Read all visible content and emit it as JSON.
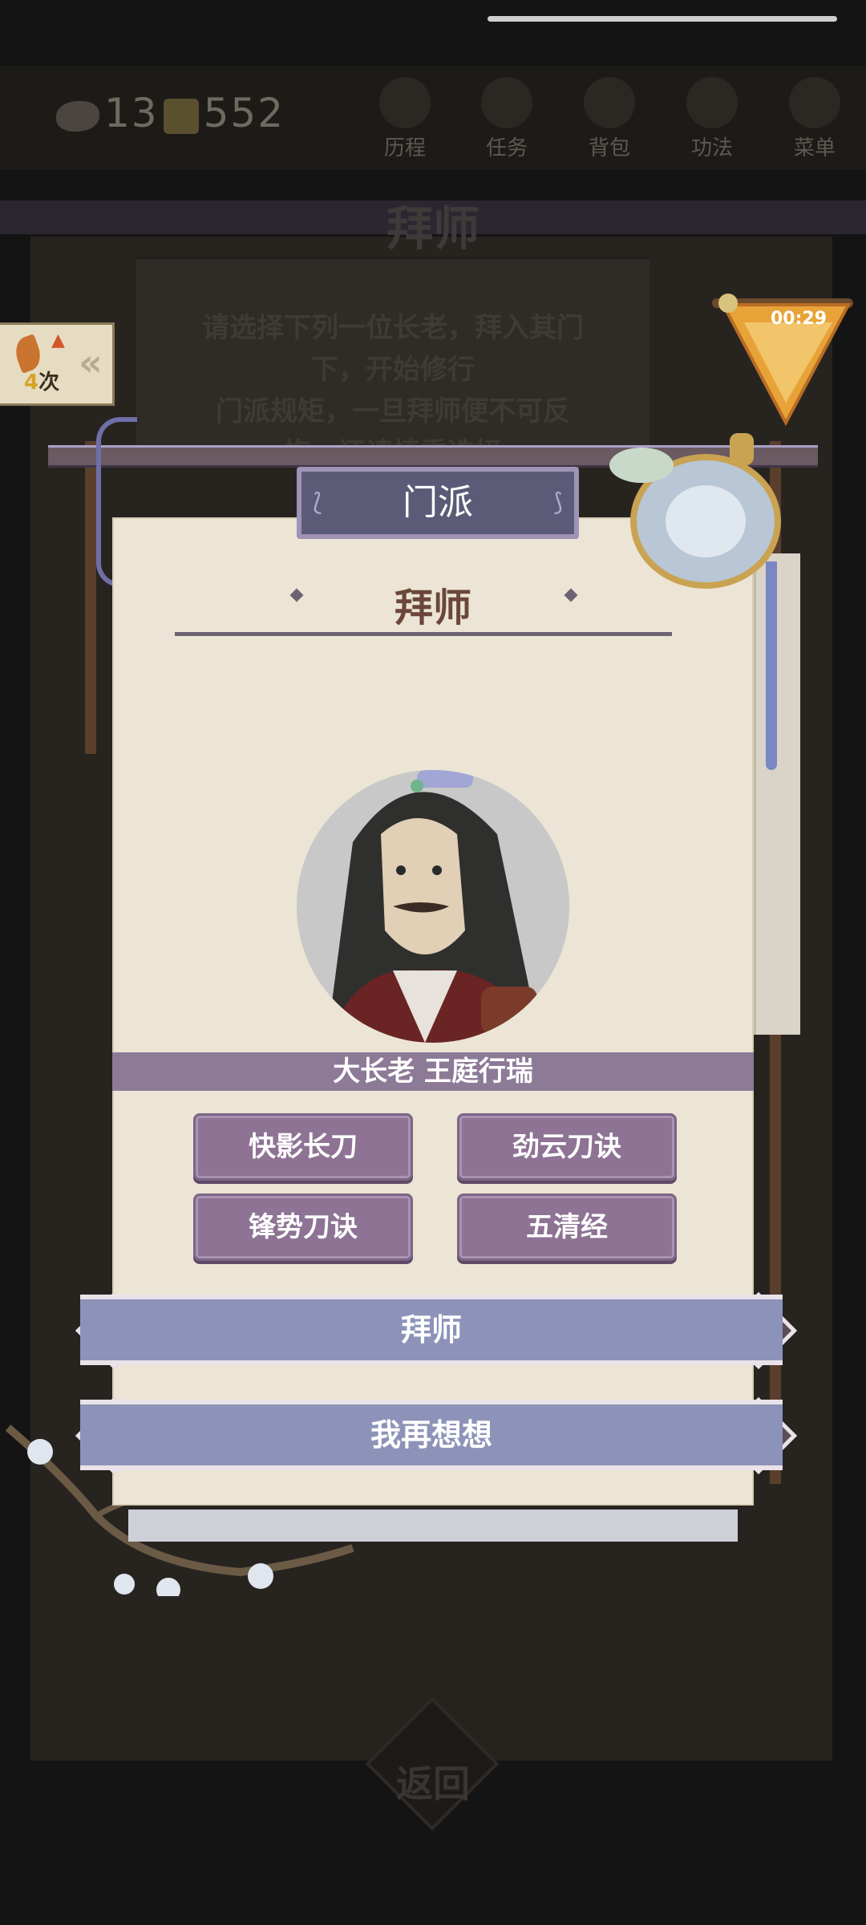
{
  "background": {
    "currency_a": "13",
    "currency_b": "552",
    "nav": [
      {
        "label": "历程",
        "icon": "scroll-icon"
      },
      {
        "label": "任务",
        "icon": "task-icon"
      },
      {
        "label": "背包",
        "icon": "bag-icon"
      },
      {
        "label": "功法",
        "icon": "book-icon"
      },
      {
        "label": "菜单",
        "icon": "fan-icon"
      }
    ],
    "title": "拜师",
    "notice_lines": [
      "请选择下列一位长老，拜入其门",
      "下，开始修行",
      "门派规矩，一旦拜师便不可反",
      "悔，还请慎重选择"
    ],
    "return_label": "返回"
  },
  "side": {
    "count_number": "4",
    "count_unit": "次",
    "timer": "00:29"
  },
  "dialog": {
    "header": "门派",
    "title": "拜师",
    "elder_name": "大长老 王庭行瑞",
    "skills": [
      "快影长刀",
      "劲云刀诀",
      "锋势刀诀",
      "五清经"
    ],
    "confirm_label": "拜师",
    "cancel_label": "我再想想"
  },
  "colors": {
    "paper": "#ece4d5",
    "accent_purple": "#8e7394",
    "button_blue": "#8d93b8",
    "title_brown": "#6a4738"
  }
}
